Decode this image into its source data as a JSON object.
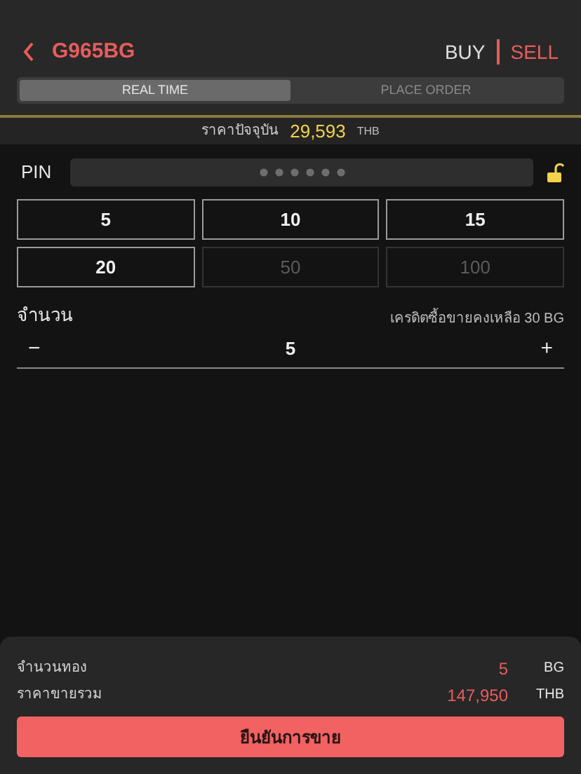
{
  "header": {
    "symbol": "G965BG",
    "sides": [
      {
        "label": "BUY",
        "selected": false
      },
      {
        "label": "SELL",
        "selected": true
      }
    ]
  },
  "tabs": [
    {
      "label": "REAL TIME",
      "selected": true
    },
    {
      "label": "PLACE ORDER",
      "selected": false
    }
  ],
  "price": {
    "label": "ราคาปัจจุบัน",
    "value": "29,593",
    "unit": "THB"
  },
  "pin": {
    "label": "PIN",
    "locked": false
  },
  "quick_amounts": [
    {
      "label": "5",
      "disabled": false
    },
    {
      "label": "10",
      "disabled": false
    },
    {
      "label": "15",
      "disabled": false
    },
    {
      "label": "20",
      "disabled": false
    },
    {
      "label": "50",
      "disabled": true
    },
    {
      "label": "100",
      "disabled": true
    }
  ],
  "quantity": {
    "label": "จำนวน",
    "credit": "เครดิตซื้อขายคงเหลือ 30 BG",
    "minus": "−",
    "value": "5",
    "plus": "+"
  },
  "summary": [
    {
      "label": "จำนวนทอง",
      "value": "5",
      "unit": "BG"
    },
    {
      "label": "ราคาขายรวม",
      "value": "147,950",
      "unit": "THB"
    }
  ],
  "confirm": "ยืนยันการขาย"
}
